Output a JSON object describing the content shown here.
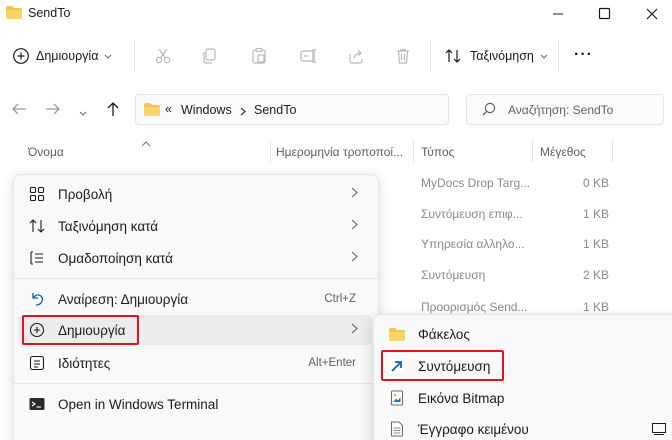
{
  "window": {
    "title": "SendTo",
    "controls": [
      "minimize",
      "maximize",
      "close"
    ]
  },
  "toolbar": {
    "new_label": "Δημιουργία",
    "sort_label": "Ταξινόμηση",
    "more_label": "···"
  },
  "address": {
    "prefix": "«",
    "crumbs": [
      "Windows",
      "SendTo"
    ],
    "search_placeholder": "Αναζήτηση: SendTo"
  },
  "columns": {
    "name": "Όνομα",
    "date": "Ημερομηνία τροποποί...",
    "type": "Τύπος",
    "size": "Μέγεθος"
  },
  "files": [
    {
      "type": "MyDocs Drop Targ...",
      "size": "0 KB"
    },
    {
      "type": "Συντόμευση επιφ...",
      "size": "1 KB"
    },
    {
      "type": "Υπηρεσία αλληλο...",
      "size": "1 KB"
    },
    {
      "type": "Συντόμευση",
      "size": "2 KB"
    },
    {
      "type": "Προορισμός Send...",
      "size": "1 KB"
    }
  ],
  "context_menu": {
    "view": "Προβολή",
    "sort_by": "Ταξινόμηση κατά",
    "group_by": "Ομαδοποίηση κατά",
    "undo": "Αναίρεση: Δημιουργία",
    "undo_shortcut": "Ctrl+Z",
    "new": "Δημιουργία",
    "properties": "Ιδιότητες",
    "properties_shortcut": "Alt+Enter",
    "terminal": "Open in Windows Terminal"
  },
  "submenu": {
    "folder": "Φάκελος",
    "shortcut": "Συντόμευση",
    "bitmap": "Εικόνα Bitmap",
    "text_doc": "Έγγραφο κειμένου"
  },
  "colors": {
    "accent": "#0067c0",
    "highlight": "#e0141e",
    "folder": "#f4c542"
  }
}
